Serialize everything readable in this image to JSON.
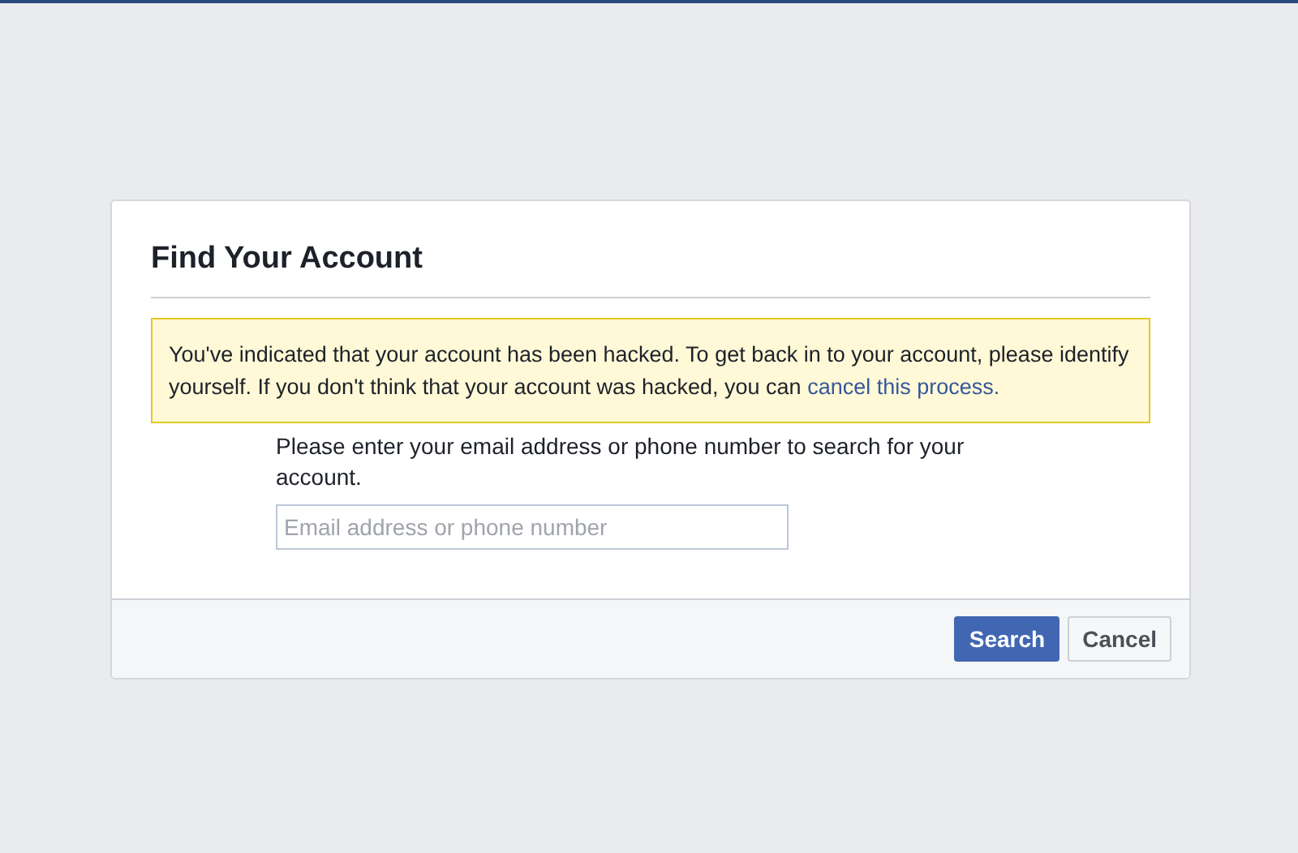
{
  "title": "Find Your Account",
  "notice": {
    "text": "You've indicated that your account has been hacked. To get back in to your account, please identify yourself. If you don't think that your account was hacked, you can ",
    "link": "cancel this process."
  },
  "instructions": "Please enter your email address or phone number to search for your account.",
  "search_field": {
    "placeholder": "Email address or phone number"
  },
  "buttons": [
    {
      "label": "Search",
      "kind": "primary"
    },
    {
      "label": "Cancel",
      "kind": "secondary"
    }
  ]
}
